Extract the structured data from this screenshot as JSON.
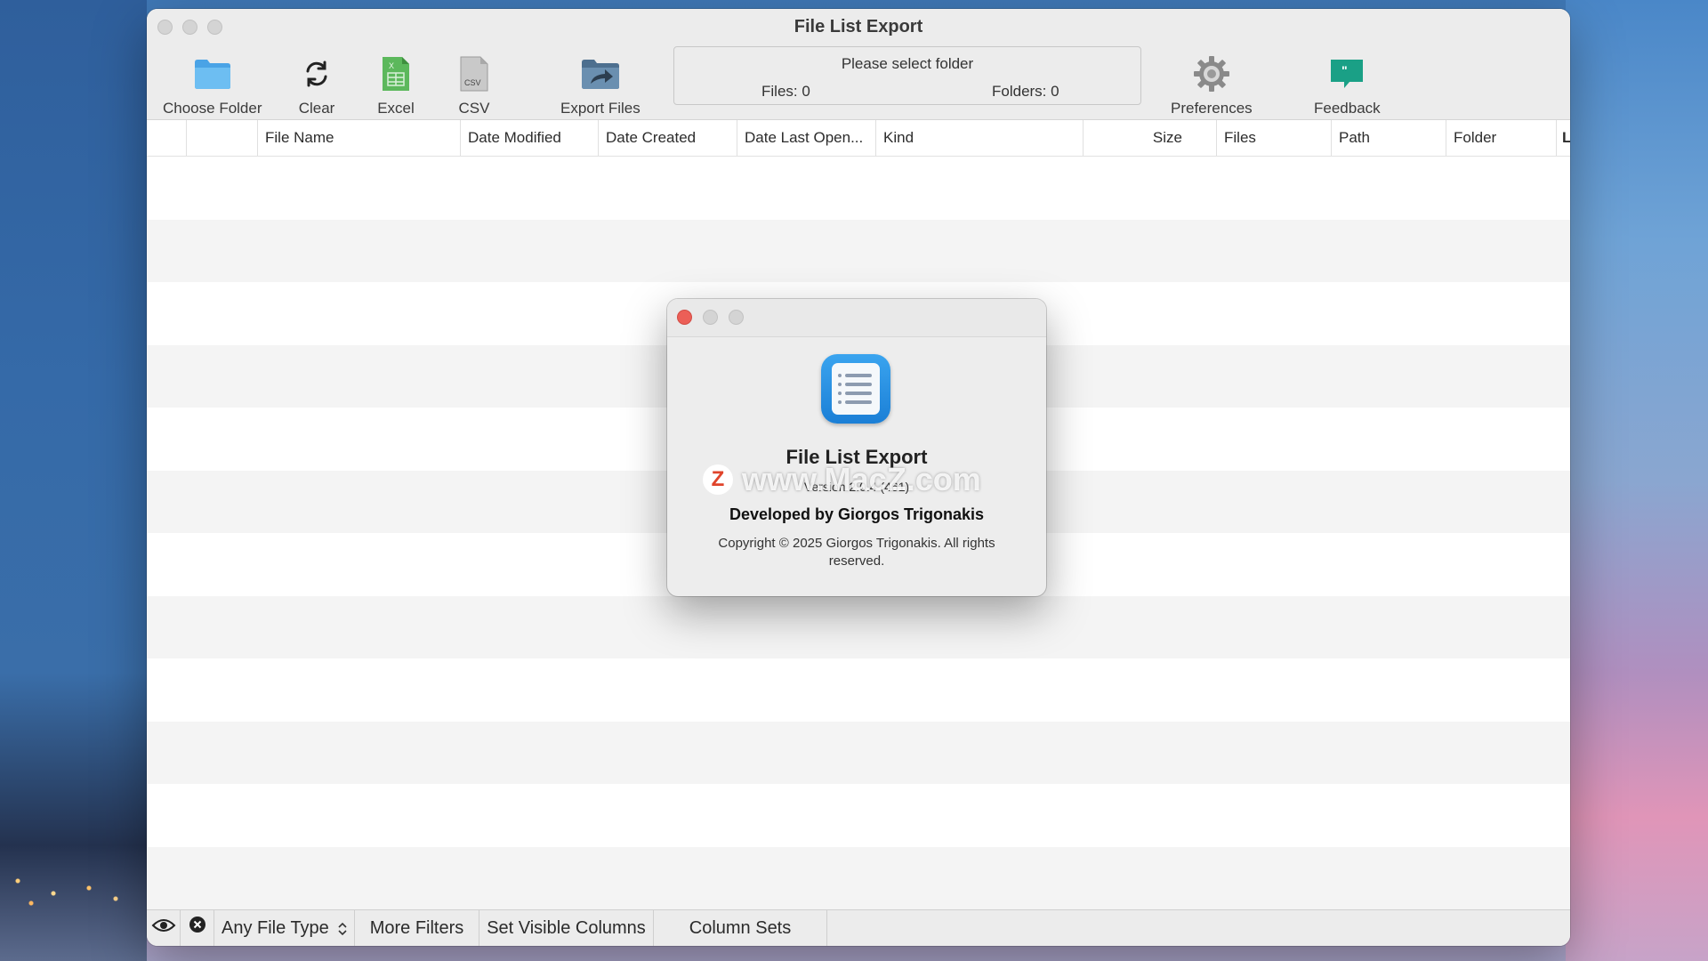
{
  "window": {
    "title": "File List Export"
  },
  "toolbar": {
    "choose_folder": "Choose Folder",
    "clear": "Clear",
    "excel": "Excel",
    "csv": "CSV",
    "export_files": "Export Files",
    "preferences": "Preferences",
    "feedback": "Feedback",
    "csv_icon_text": "CSV"
  },
  "status": {
    "message": "Please select folder",
    "files": "Files: 0",
    "folders": "Folders: 0"
  },
  "columns": [
    "File Name",
    "Date Modified",
    "Date Created",
    "Date Last Open...",
    "Kind",
    "Size",
    "Files",
    "Path",
    "Folder",
    "L"
  ],
  "bottom_bar": {
    "file_type": "Any File Type",
    "more_filters": "More Filters",
    "set_visible_columns": "Set Visible Columns",
    "column_sets": "Column Sets"
  },
  "about": {
    "app_name": "File List Export",
    "version": "Version 2.0.4 (461)",
    "developer": "Developed by Giorgos Trigonakis",
    "copyright": "Copyright © 2025 Giorgos Trigonakis. All rights reserved."
  },
  "watermark": {
    "logo": "Z",
    "text": "www.MacZ.com"
  },
  "colors": {
    "close_red": "#ec5f57",
    "folder_blue": "#5aaee8",
    "excel_green": "#4caf50",
    "feedback_teal": "#1aa086",
    "app_icon_blue": "#1b7fd6"
  },
  "icons": {
    "choose_folder": "folder-icon",
    "clear": "refresh-icon",
    "excel": "excel-file-icon",
    "csv": "csv-file-icon",
    "export": "export-arrow-icon",
    "preferences": "gear-icon",
    "feedback": "speech-bubble-icon",
    "visibility": "eye-icon",
    "clear_filter": "close-circle-icon"
  }
}
